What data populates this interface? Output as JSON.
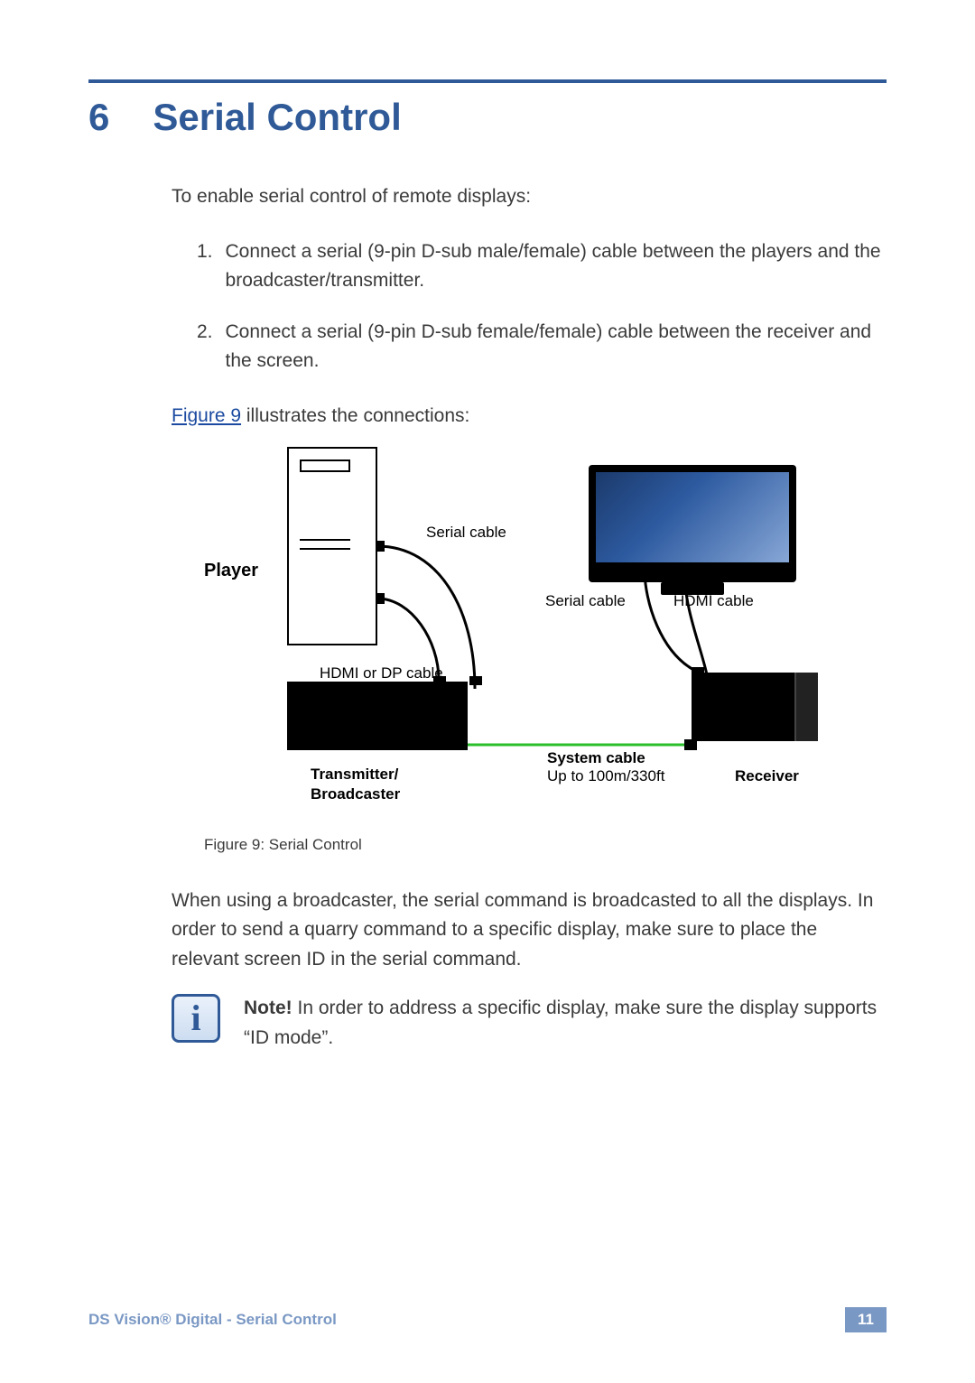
{
  "chapter": {
    "number": "6",
    "title": "Serial Control"
  },
  "intro": "To enable serial control of remote displays:",
  "steps": [
    {
      "n": "1.",
      "text": "Connect a serial (9-pin D-sub male/female) cable between the players and the broadcaster/transmitter."
    },
    {
      "n": "2.",
      "text": "Connect a serial (9-pin D-sub female/female) cable between the receiver and the screen."
    }
  ],
  "figref": {
    "link": "Figure 9",
    "rest": " illustrates the connections:"
  },
  "diagram": {
    "player": "Player",
    "serial_cable_1": "Serial cable",
    "hdmi_dp": "HDMI or DP cable",
    "transmitter": "Transmitter/\nBroadcaster",
    "serial_cable_2": "Serial cable",
    "hdmi_cable": "HDMI cable",
    "system_cable": "System cable",
    "system_cable_sub": "Up to 100m/330ft",
    "receiver": "Receiver"
  },
  "caption": "Figure 9: Serial Control",
  "paragraph": "When using a broadcaster, the serial command is broadcasted to all the displays. In order to send a quarry command to a specific display, make sure to place the relevant screen ID in the serial command.",
  "note": {
    "bold": "Note!",
    "text": " In order to address a specific display, make sure the display supports “ID mode”."
  },
  "footer": {
    "left": "DS Vision® Digital - Serial Control",
    "page": "11"
  }
}
